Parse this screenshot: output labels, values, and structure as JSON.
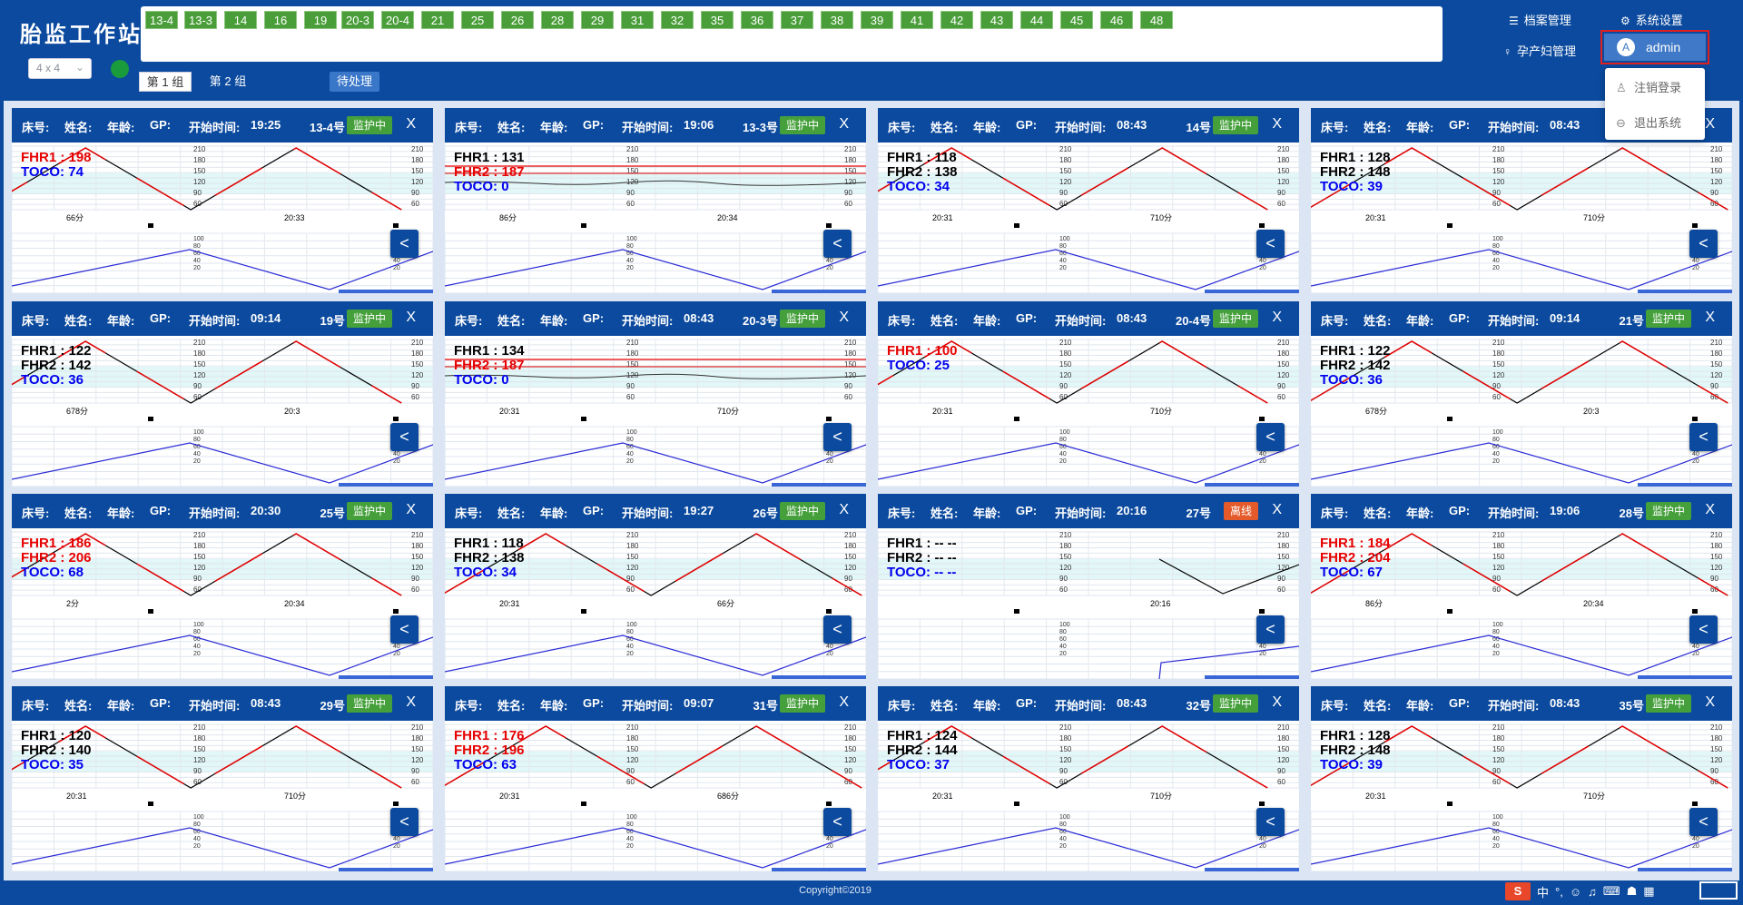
{
  "app": {
    "title": "胎监工作站",
    "layout_option": "4 x 4",
    "copyright": "Copyright©2019"
  },
  "bed_bar": [
    "13-4",
    "13-3",
    "14",
    "16",
    "19",
    "20-3",
    "20-4",
    "21",
    "25",
    "26",
    "28",
    "29",
    "31",
    "32",
    "35",
    "36",
    "37",
    "38",
    "39",
    "41",
    "42",
    "43",
    "44",
    "45",
    "46",
    "48"
  ],
  "group_tabs": {
    "group1": "第 1 组",
    "group2": "第 2 组",
    "pending": "待处理"
  },
  "header_links": {
    "records": "档案管理",
    "settings": "系统设置",
    "patients": "孕产妇管理",
    "user": "admin",
    "user_avatar": "A"
  },
  "user_menu": {
    "logout": "注销登录",
    "exit": "退出系统"
  },
  "card_labels": {
    "bed": "床号:",
    "name": "姓名:",
    "age": "年龄:",
    "gp": "GP:",
    "start": "开始时间:",
    "close": "X",
    "collapse": "<"
  },
  "colors": {
    "header_blue": "#0b4a9e",
    "monitoring_green": "#45a03b",
    "offline_orange": "#e55a2a",
    "fhr1_red": "#e60000",
    "fhr2_black": "#000000",
    "toco_blue": "#0000ee"
  },
  "cards": [
    {
      "bed": "13-4号",
      "start": "19:25",
      "status": "监护中",
      "offline": false,
      "fhr1": "FHR1 : 198",
      "fhr2": "",
      "toco": "TOCO: 74",
      "fhr1_red": true,
      "fhr2_red": false,
      "wave": "tri",
      "axis_a": "66分",
      "axis_b": "20:33"
    },
    {
      "bed": "13-3号",
      "start": "19:06",
      "status": "监护中",
      "offline": false,
      "fhr1": "FHR1 : 131",
      "fhr2": "FHR2 : 187",
      "toco": "TOCO: 0",
      "fhr1_red": false,
      "fhr2_red": true,
      "wave": "flat",
      "axis_a": "86分",
      "axis_b": "20:34"
    },
    {
      "bed": "14号",
      "start": "08:43",
      "status": "监护中",
      "offline": false,
      "fhr1": "FHR1 : 118",
      "fhr2": "FHR2 : 138",
      "toco": "TOCO: 34",
      "fhr1_red": false,
      "fhr2_red": false,
      "wave": "tri",
      "axis_a": "20:31",
      "axis_b": "710分"
    },
    {
      "bed": "",
      "start": "08:43",
      "status": "",
      "offline": false,
      "fhr1": "FHR1 : 128",
      "fhr2": "FHR2 : 148",
      "toco": "TOCO: 39",
      "fhr1_red": false,
      "fhr2_red": false,
      "wave": "tri",
      "axis_a": "20:31",
      "axis_b": "710分"
    },
    {
      "bed": "19号",
      "start": "09:14",
      "status": "监护中",
      "offline": false,
      "fhr1": "FHR1 : 122",
      "fhr2": "FHR2 : 142",
      "toco": "TOCO: 36",
      "fhr1_red": false,
      "fhr2_red": false,
      "wave": "tri",
      "axis_a": "678分",
      "axis_b": "20:3"
    },
    {
      "bed": "20-3号",
      "start": "08:43",
      "status": "监护中",
      "offline": false,
      "fhr1": "FHR1 : 134",
      "fhr2": "FHR2 : 187",
      "toco": "TOCO: 0",
      "fhr1_red": false,
      "fhr2_red": true,
      "wave": "flat",
      "axis_a": "20:31",
      "axis_b": "710分"
    },
    {
      "bed": "20-4号",
      "start": "08:43",
      "status": "监护中",
      "offline": false,
      "fhr1": "FHR1 : 100",
      "fhr2": "",
      "toco": "TOCO: 25",
      "fhr1_red": true,
      "fhr2_red": false,
      "wave": "tri",
      "axis_a": "20:31",
      "axis_b": "710分"
    },
    {
      "bed": "21号",
      "start": "09:14",
      "status": "监护中",
      "offline": false,
      "fhr1": "FHR1 : 122",
      "fhr2": "FHR2 : 142",
      "toco": "TOCO: 36",
      "fhr1_red": false,
      "fhr2_red": false,
      "wave": "tri",
      "axis_a": "678分",
      "axis_b": "20:3"
    },
    {
      "bed": "25号",
      "start": "20:30",
      "status": "监护中",
      "offline": false,
      "fhr1": "FHR1 : 186",
      "fhr2": "FHR2 : 206",
      "toco": "TOCO: 68",
      "fhr1_red": true,
      "fhr2_red": true,
      "wave": "tri",
      "axis_a": "2分",
      "axis_b": "20:34"
    },
    {
      "bed": "26号",
      "start": "19:27",
      "status": "监护中",
      "offline": false,
      "fhr1": "FHR1 : 118",
      "fhr2": "FHR2 : 138",
      "toco": "TOCO: 34",
      "fhr1_red": false,
      "fhr2_red": false,
      "wave": "tri",
      "axis_a": "20:31",
      "axis_b": "66分"
    },
    {
      "bed": "27号",
      "start": "20:16",
      "status": "离线",
      "offline": true,
      "fhr1": "FHR1 : -- --",
      "fhr2": "FHR2 : -- --",
      "toco": "TOCO: -- --",
      "fhr1_red": false,
      "fhr2_red": false,
      "wave": "partial",
      "axis_a": "",
      "axis_b": "20:16"
    },
    {
      "bed": "28号",
      "start": "19:06",
      "status": "监护中",
      "offline": false,
      "fhr1": "FHR1 : 184",
      "fhr2": "FHR2 : 204",
      "toco": "TOCO: 67",
      "fhr1_red": true,
      "fhr2_red": true,
      "wave": "tri",
      "axis_a": "86分",
      "axis_b": "20:34"
    },
    {
      "bed": "29号",
      "start": "08:43",
      "status": "监护中",
      "offline": false,
      "fhr1": "FHR1 : 120",
      "fhr2": "FHR2 : 140",
      "toco": "TOCO: 35",
      "fhr1_red": false,
      "fhr2_red": false,
      "wave": "tri",
      "axis_a": "20:31",
      "axis_b": "710分"
    },
    {
      "bed": "31号",
      "start": "09:07",
      "status": "监护中",
      "offline": false,
      "fhr1": "FHR1 : 176",
      "fhr2": "FHR2 : 196",
      "toco": "TOCO: 63",
      "fhr1_red": true,
      "fhr2_red": true,
      "wave": "tri",
      "axis_a": "20:31",
      "axis_b": "686分"
    },
    {
      "bed": "32号",
      "start": "08:43",
      "status": "监护中",
      "offline": false,
      "fhr1": "FHR1 : 124",
      "fhr2": "FHR2 : 144",
      "toco": "TOCO: 37",
      "fhr1_red": false,
      "fhr2_red": false,
      "wave": "tri",
      "axis_a": "20:31",
      "axis_b": "710分"
    },
    {
      "bed": "35号",
      "start": "08:43",
      "status": "监护中",
      "offline": false,
      "fhr1": "FHR1 : 128",
      "fhr2": "FHR2 : 148",
      "toco": "TOCO: 39",
      "fhr1_red": false,
      "fhr2_red": false,
      "wave": "tri",
      "axis_a": "20:31",
      "axis_b": "710分"
    }
  ],
  "fhr_ticks": [
    "210",
    "180",
    "150",
    "120",
    "90",
    "60"
  ],
  "toco_ticks": [
    "100",
    "80",
    "60",
    "40",
    "20"
  ],
  "tray": {
    "input_lang": "中",
    "punct": "°,"
  }
}
